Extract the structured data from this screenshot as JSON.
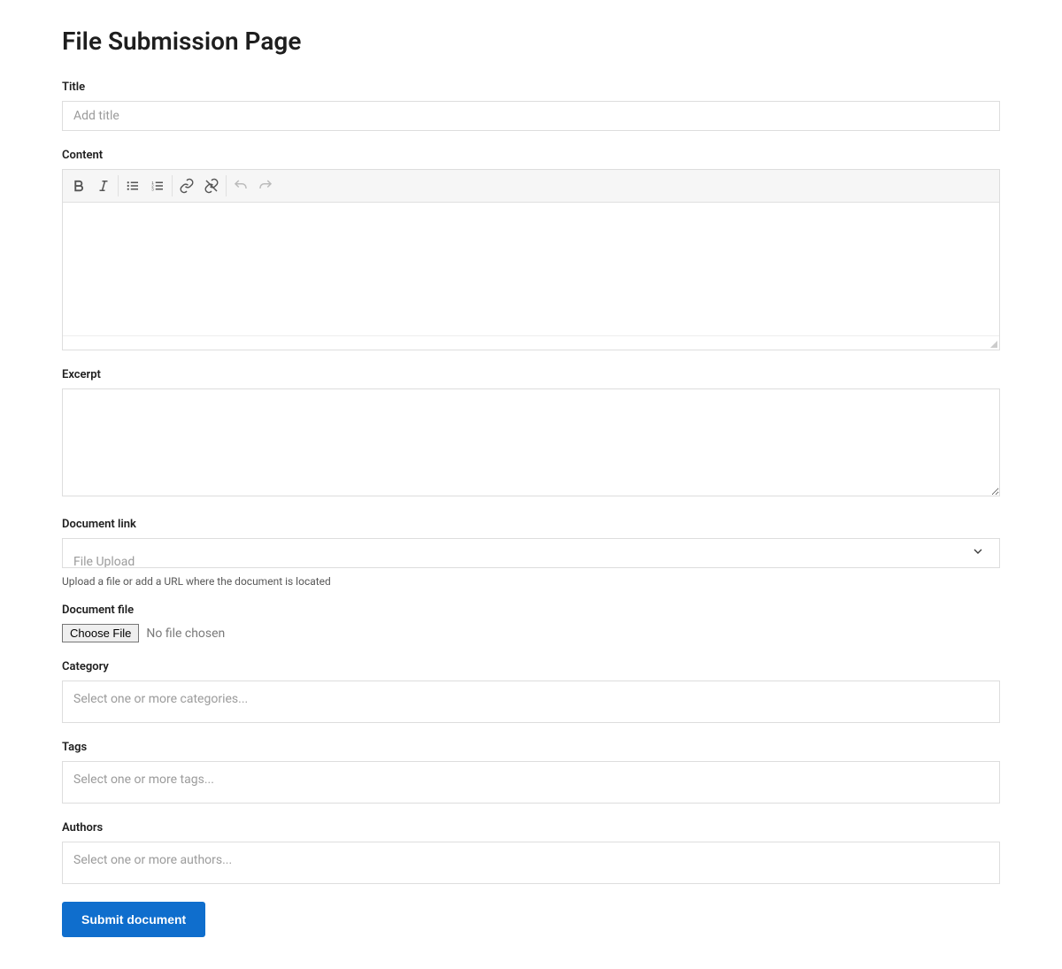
{
  "page": {
    "title": "File Submission Page"
  },
  "fields": {
    "title": {
      "label": "Title",
      "placeholder": "Add title",
      "value": ""
    },
    "content": {
      "label": "Content",
      "value": "",
      "toolbar_icons": [
        "bold",
        "italic",
        "bullet-list",
        "ordered-list",
        "link",
        "unlink",
        "undo",
        "redo"
      ]
    },
    "excerpt": {
      "label": "Excerpt",
      "value": ""
    },
    "document_link": {
      "label": "Document link",
      "selected": "File Upload",
      "help": "Upload a file or add a URL where the document is located"
    },
    "document_file": {
      "label": "Document file",
      "button": "Choose File",
      "status": "No file chosen"
    },
    "category": {
      "label": "Category",
      "placeholder": "Select one or more categories..."
    },
    "tags": {
      "label": "Tags",
      "placeholder": "Select one or more tags..."
    },
    "authors": {
      "label": "Authors",
      "placeholder": "Select one or more authors..."
    }
  },
  "buttons": {
    "submit": "Submit document"
  }
}
